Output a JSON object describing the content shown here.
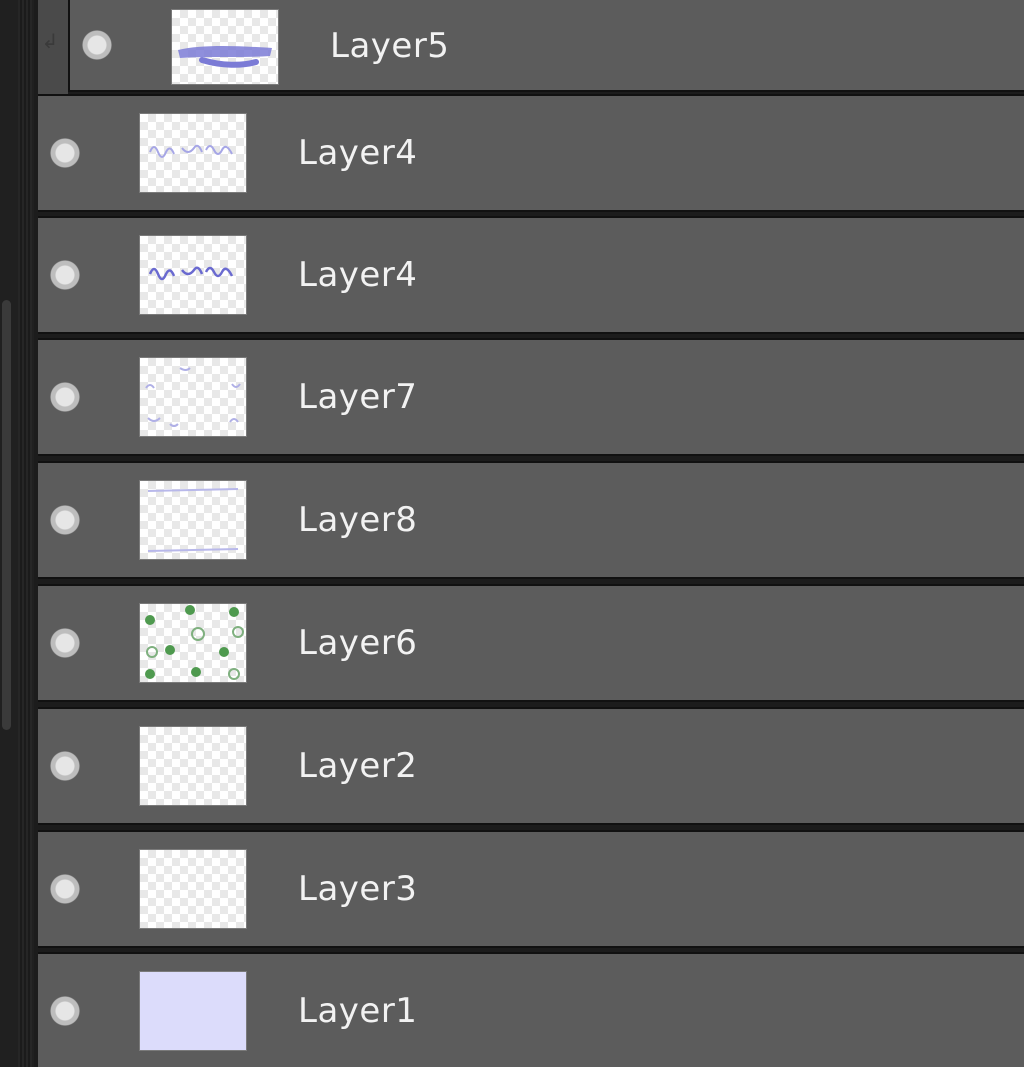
{
  "layers_panel": {
    "layers": [
      {
        "name": "Layer5",
        "visible": true,
        "thumbnail": "purple-brush-stroke",
        "clipped": true
      },
      {
        "name": "Layer4",
        "visible": true,
        "thumbnail": "handwriting-light"
      },
      {
        "name": "Layer4",
        "visible": true,
        "thumbnail": "handwriting-dark"
      },
      {
        "name": "Layer7",
        "visible": true,
        "thumbnail": "corner-scribbles"
      },
      {
        "name": "Layer8",
        "visible": true,
        "thumbnail": "border-lines"
      },
      {
        "name": "Layer6",
        "visible": true,
        "thumbnail": "green-dots"
      },
      {
        "name": "Layer2",
        "visible": true,
        "thumbnail": "empty-transparent"
      },
      {
        "name": "Layer3",
        "visible": true,
        "thumbnail": "empty-transparent"
      },
      {
        "name": "Layer1",
        "visible": true,
        "thumbnail": "solid-lavender"
      }
    ]
  },
  "colors": {
    "row_background": "#5c5c5c",
    "row_separator": "#111111",
    "label_text": "#f2f2f2",
    "layer1_fill": "#dcdcfb",
    "ink_purple": "#7b7bd6",
    "ink_green": "#4f9a4f"
  }
}
